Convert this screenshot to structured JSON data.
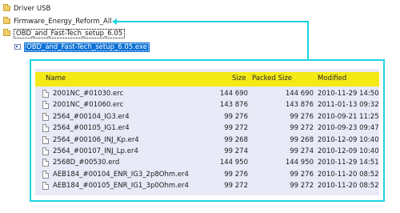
{
  "tree": {
    "items": [
      {
        "label": "Driver USB"
      },
      {
        "label": "Firmware_Energy_Reform_All"
      },
      {
        "label": "OBD_and_Fast-Tech_setup_6.05"
      },
      {
        "label": "OBD_and_Fast-Tech_setup_6.05.exe"
      }
    ]
  },
  "colors": {
    "connector": "#1fd3e0",
    "header_bg": "#f4ea16",
    "list_bg": "#e9eaf7",
    "selection": "#0a6fd4"
  },
  "archive": {
    "columns": [
      "Name",
      "Size",
      "Packed Size",
      "Modified"
    ],
    "rows": [
      {
        "name": "2001NC_#01030.erc",
        "size": "144 690",
        "packed": "144 690",
        "modified": "2010-11-29 14:50"
      },
      {
        "name": "2001NC_#01060.erc",
        "size": "143 876",
        "packed": "143 876",
        "modified": "2011-01-13 09:32"
      },
      {
        "name": "2564_#00104_IG3.er4",
        "size": "99 276",
        "packed": "99 276",
        "modified": "2010-09-21 11:25"
      },
      {
        "name": "2564_#00105_IG1.er4",
        "size": "99 272",
        "packed": "99 272",
        "modified": "2010-09-23 09:47"
      },
      {
        "name": "2564_#00106_INJ_Kp.er4",
        "size": "99 268",
        "packed": "99 268",
        "modified": "2010-12-09 10:40"
      },
      {
        "name": "2564_#00107_INJ_Lp.er4",
        "size": "99 274",
        "packed": "99 274",
        "modified": "2010-12-09 10:40"
      },
      {
        "name": "2568D_#00530.erd",
        "size": "144 950",
        "packed": "144 950",
        "modified": "2010-11-29 14:51"
      },
      {
        "name": "AEB184_#00104_ENR_IG3_2p8Ohm.er4",
        "size": "99 276",
        "packed": "99 276",
        "modified": "2010-11-20 08:52"
      },
      {
        "name": "AEB184_#00105_ENR_IG1_3p0Ohm.er4",
        "size": "99 272",
        "packed": "99 272",
        "modified": "2010-11-20 08:52"
      }
    ]
  }
}
